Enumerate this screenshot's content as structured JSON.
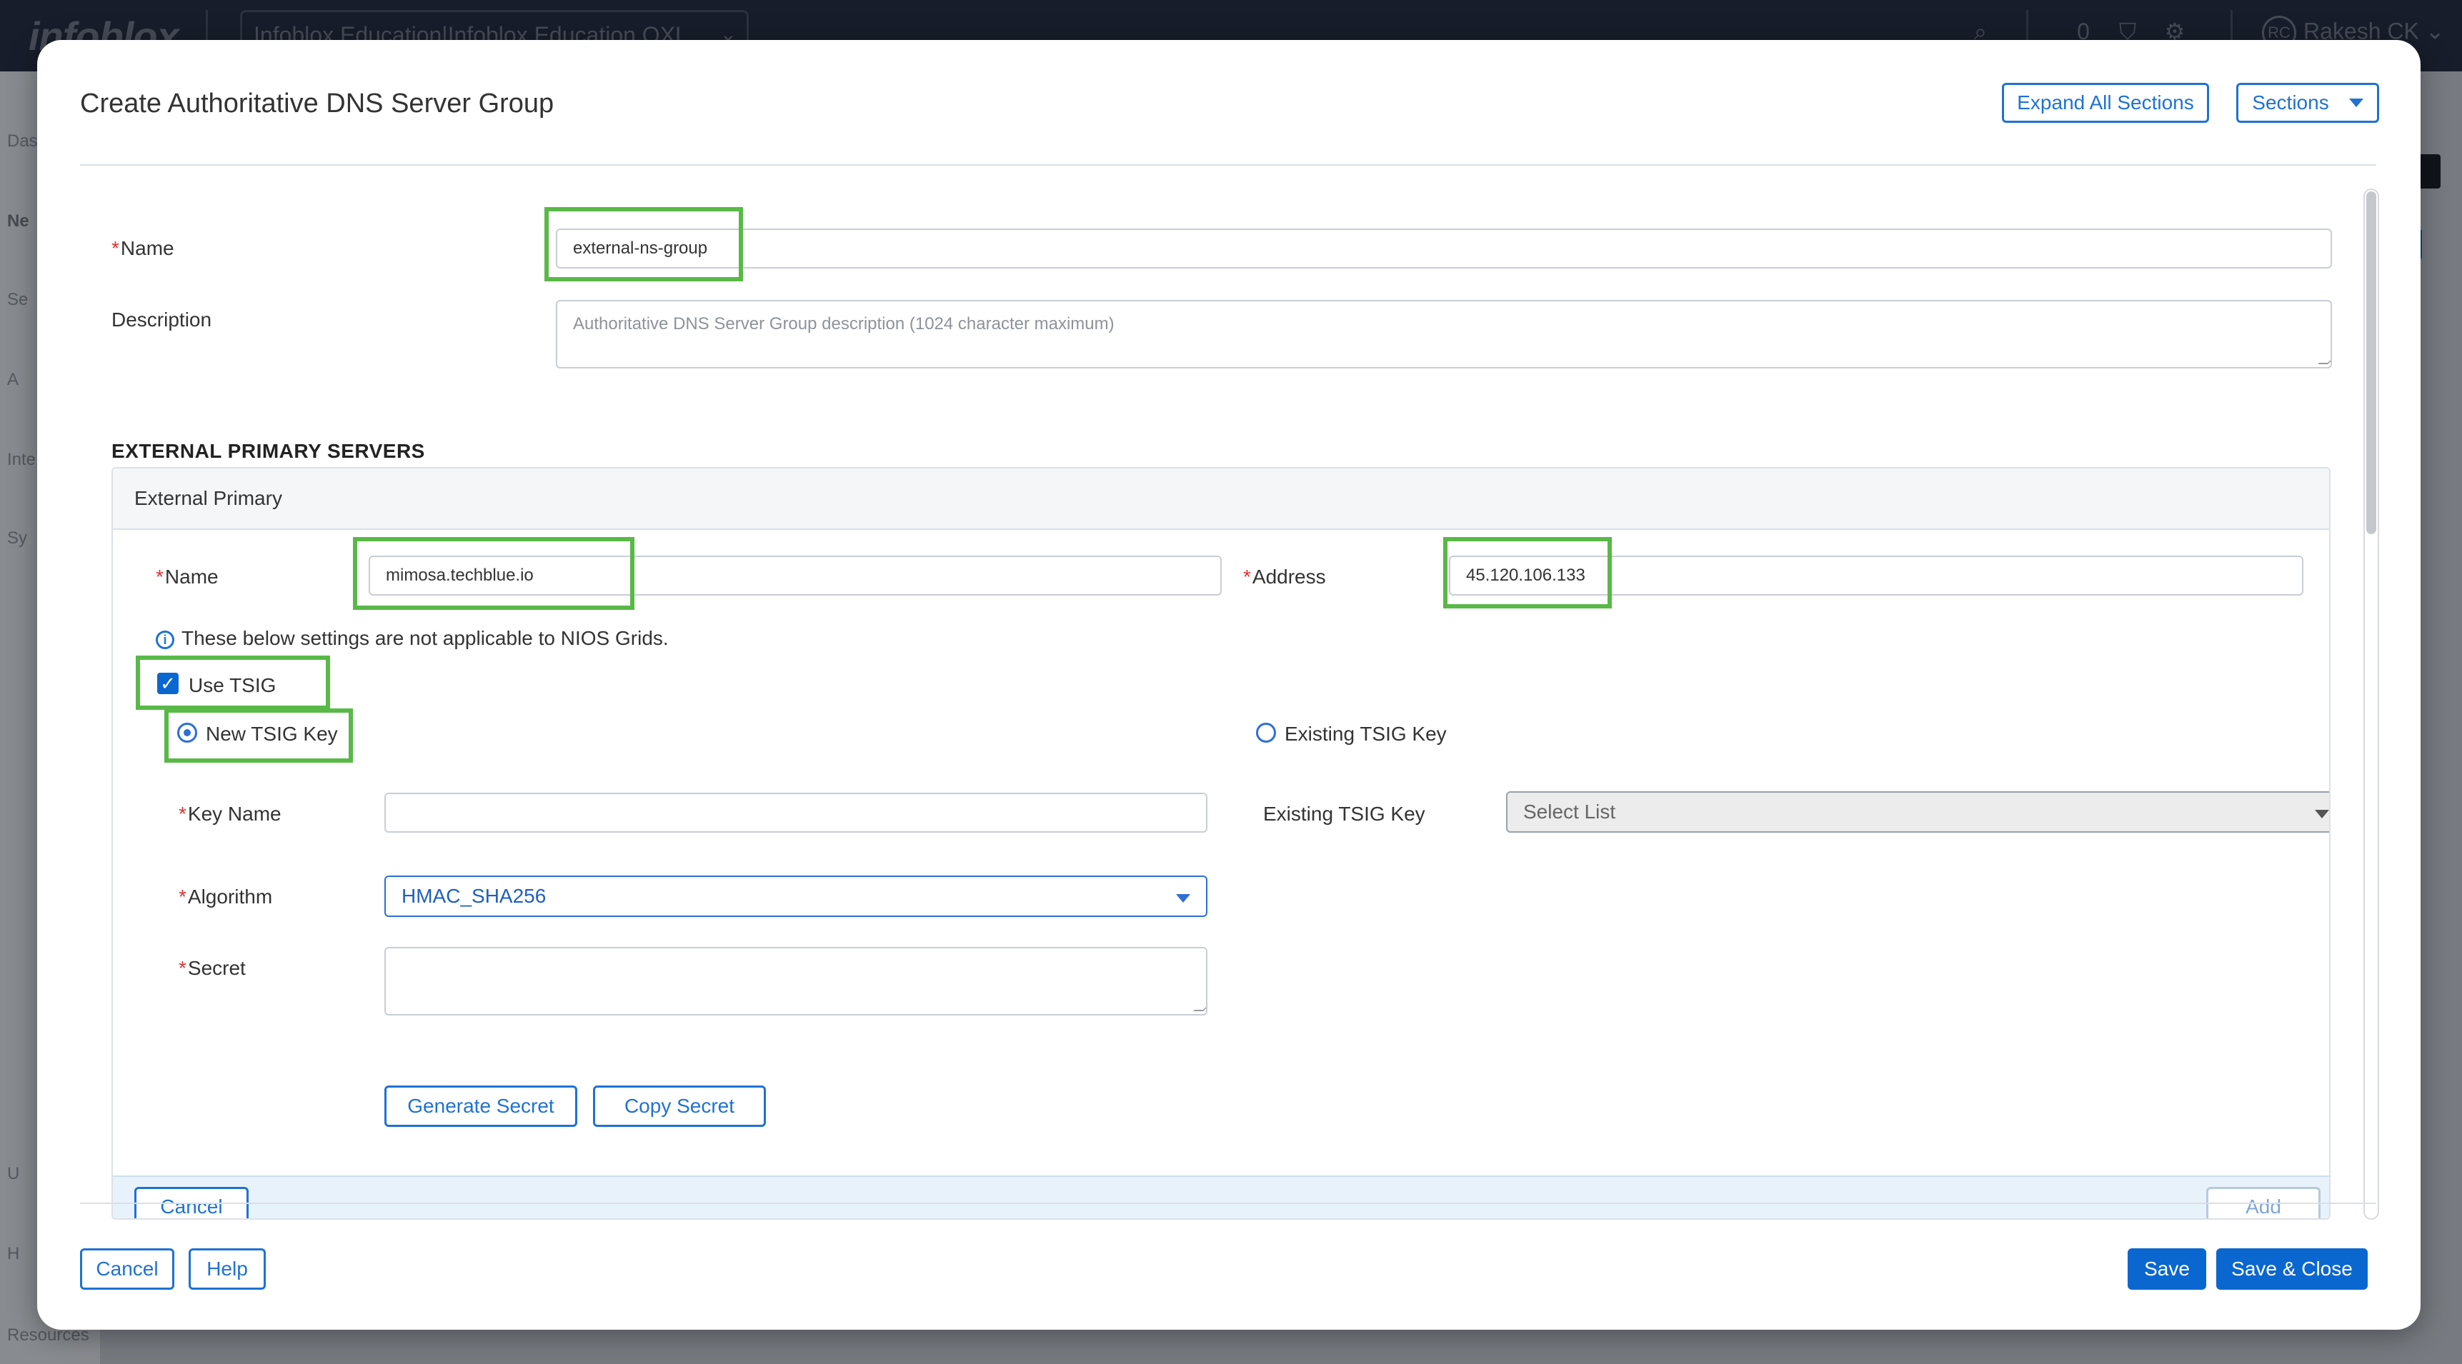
{
  "background_app": {
    "logo": "infoblox",
    "account_selector": "Infoblox Education|Infoblox Education OXL",
    "notifications_count": "0",
    "user_initials": "RC",
    "user_name": "Rakesh CK",
    "sidebar_items": [
      "Das",
      "Ne",
      "Se",
      "A",
      "Inte",
      "Sy",
      "U",
      "H",
      "Resources"
    ]
  },
  "modal": {
    "title": "Create Authoritative DNS Server Group",
    "expand_all_label": "Expand All Sections",
    "sections_label": "Sections",
    "form": {
      "name_label": "Name",
      "name_value": "external-ns-group",
      "description_label": "Description",
      "description_placeholder": "Authoritative DNS Server Group description (1024 character maximum)",
      "section_heading": "EXTERNAL PRIMARY SERVERS",
      "external_primary": {
        "panel_title": "External Primary",
        "name_label": "Name",
        "name_value": "mimosa.techblue.io",
        "address_label": "Address",
        "address_value": "45.120.106.133",
        "info_text": "These below settings are not applicable to NIOS Grids.",
        "use_tsig_label": "Use TSIG",
        "use_tsig_checked": true,
        "new_tsig_label": "New TSIG Key",
        "existing_tsig_radio_label": "Existing TSIG Key",
        "key_name_label": "Key Name",
        "key_name_value": "",
        "algorithm_label": "Algorithm",
        "algorithm_value": "HMAC_SHA256",
        "secret_label": "Secret",
        "secret_value": "",
        "existing_tsig_label": "Existing TSIG Key",
        "existing_tsig_value": "Select List",
        "generate_secret_label": "Generate Secret",
        "copy_secret_label": "Copy Secret",
        "cancel_label": "Cancel",
        "add_label": "Add"
      }
    },
    "footer": {
      "cancel_label": "Cancel",
      "help_label": "Help",
      "save_label": "Save",
      "save_close_label": "Save & Close"
    }
  },
  "colors": {
    "highlight": "#58b947",
    "primary": "#0a67cf",
    "link": "#1f72d2",
    "required": "#dd3333"
  }
}
